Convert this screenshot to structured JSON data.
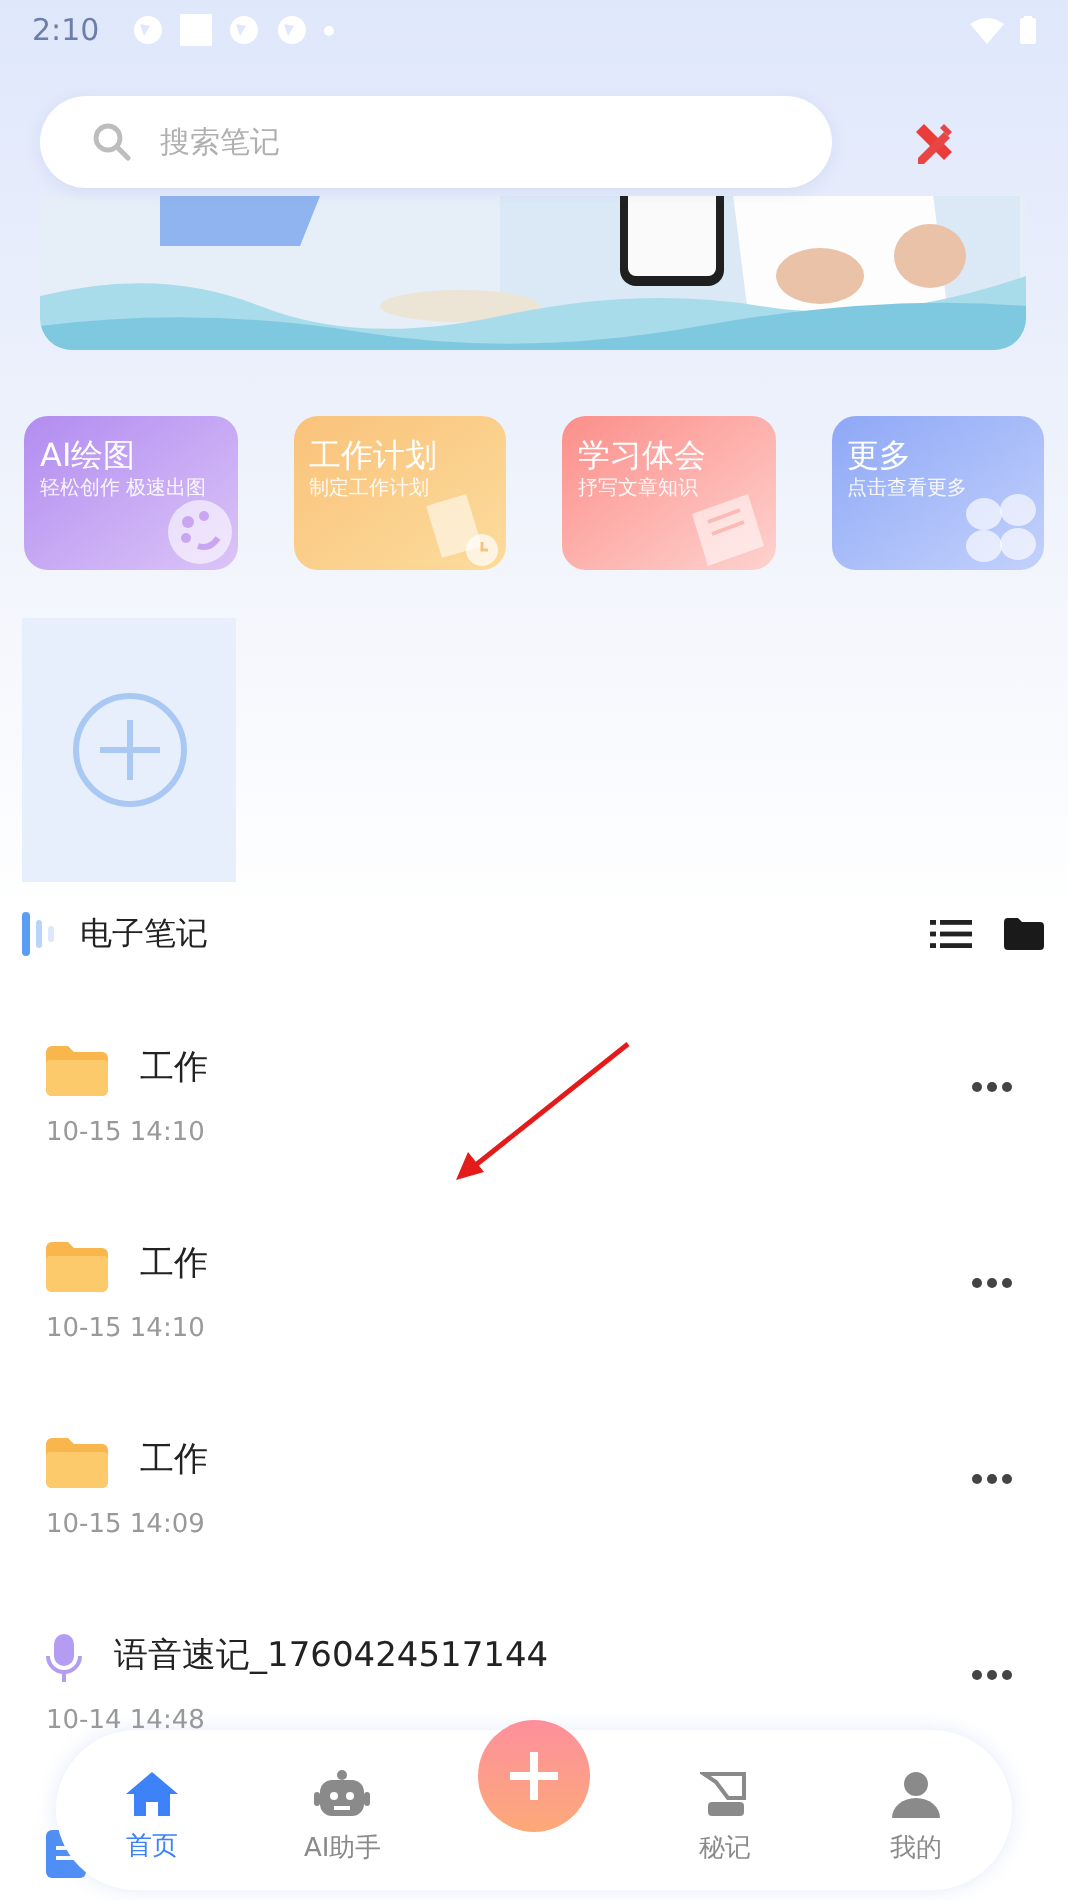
{
  "status_bar": {
    "time": "2:10"
  },
  "search": {
    "placeholder": "搜索笔记"
  },
  "shortcuts": [
    {
      "kind": "paint",
      "title": "AI绘图",
      "subtitle": "轻松创作 极速出图"
    },
    {
      "kind": "plan",
      "title": "工作计划",
      "subtitle": "制定工作计划"
    },
    {
      "kind": "study",
      "title": "学习体会",
      "subtitle": "抒写文章知识"
    },
    {
      "kind": "more",
      "title": "更多",
      "subtitle": "点击查看更多"
    }
  ],
  "section": {
    "title": "电子笔记"
  },
  "notes": [
    {
      "kind": "folder",
      "title": "工作",
      "time": "10-15 14:10"
    },
    {
      "kind": "folder",
      "title": "工作",
      "time": "10-15 14:10"
    },
    {
      "kind": "folder",
      "title": "工作",
      "time": "10-15 14:09"
    },
    {
      "kind": "voice",
      "title": "语音速记_1760424517144",
      "time": "10-14 14:48"
    },
    {
      "kind": "doc"
    }
  ],
  "bottom_nav": [
    {
      "kind": "home",
      "label": "首页",
      "selected": true
    },
    {
      "kind": "robot",
      "label": "AI助手",
      "selected": false
    },
    {
      "kind": "add"
    },
    {
      "kind": "secret",
      "label": "秘记",
      "selected": false
    },
    {
      "kind": "me",
      "label": "我的",
      "selected": false
    }
  ]
}
